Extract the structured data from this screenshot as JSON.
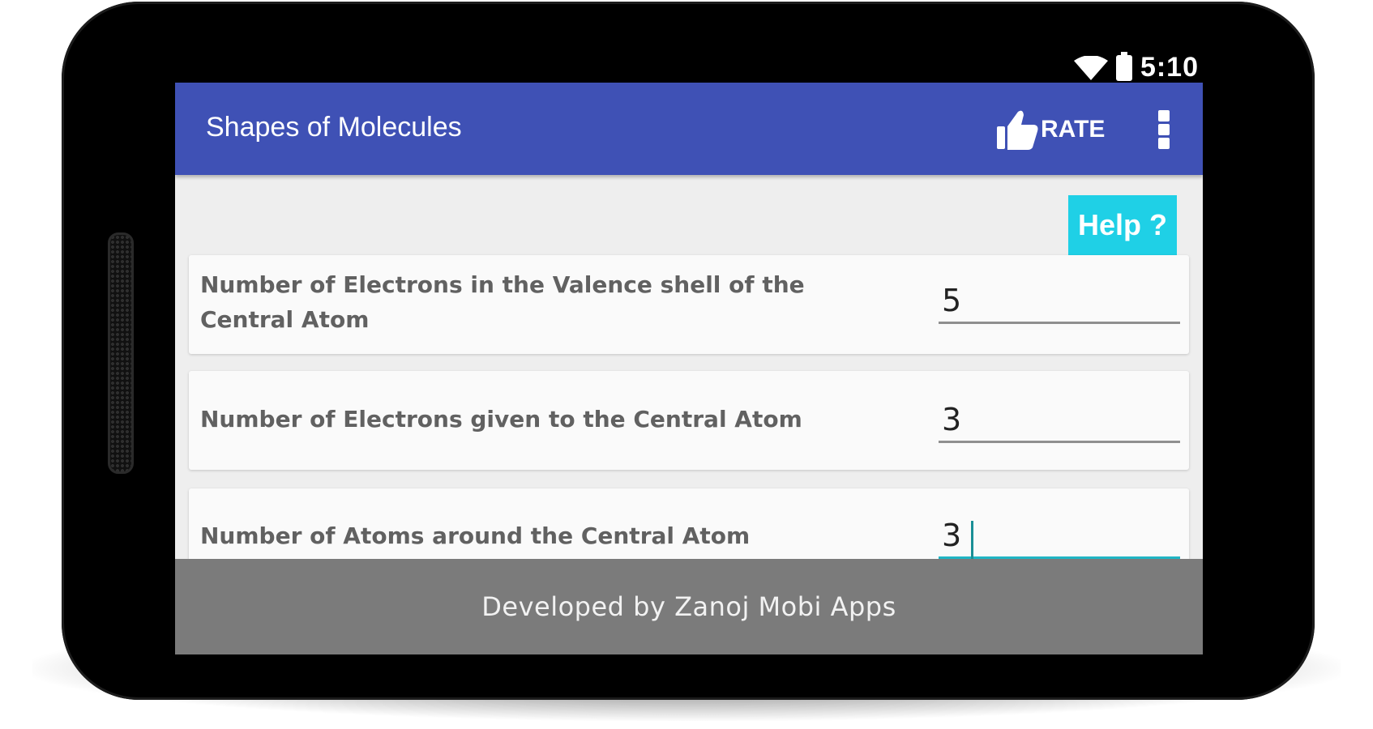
{
  "status_bar": {
    "time": "5:10",
    "icons": [
      "wifi-icon",
      "battery-icon"
    ]
  },
  "app_bar": {
    "title": "Shapes of Molecules",
    "rate_label": "RATE",
    "rate_icon": "thumbs-up-icon",
    "menu_icon": "overflow-menu-icon",
    "color": "#3f51b5"
  },
  "help_button": {
    "label": "Help ?",
    "color": "#1fd0e6"
  },
  "fields": [
    {
      "label": "Number of Electrons in the Valence shell of the Central Atom",
      "value": "5"
    },
    {
      "label": "Number of Electrons given to the Central Atom",
      "value": "3"
    },
    {
      "label": "Number of Atoms around the Central Atom",
      "value": "3"
    }
  ],
  "footer": {
    "text": "Developed by Zanoj Mobi Apps",
    "color": "#7b7b7b"
  }
}
